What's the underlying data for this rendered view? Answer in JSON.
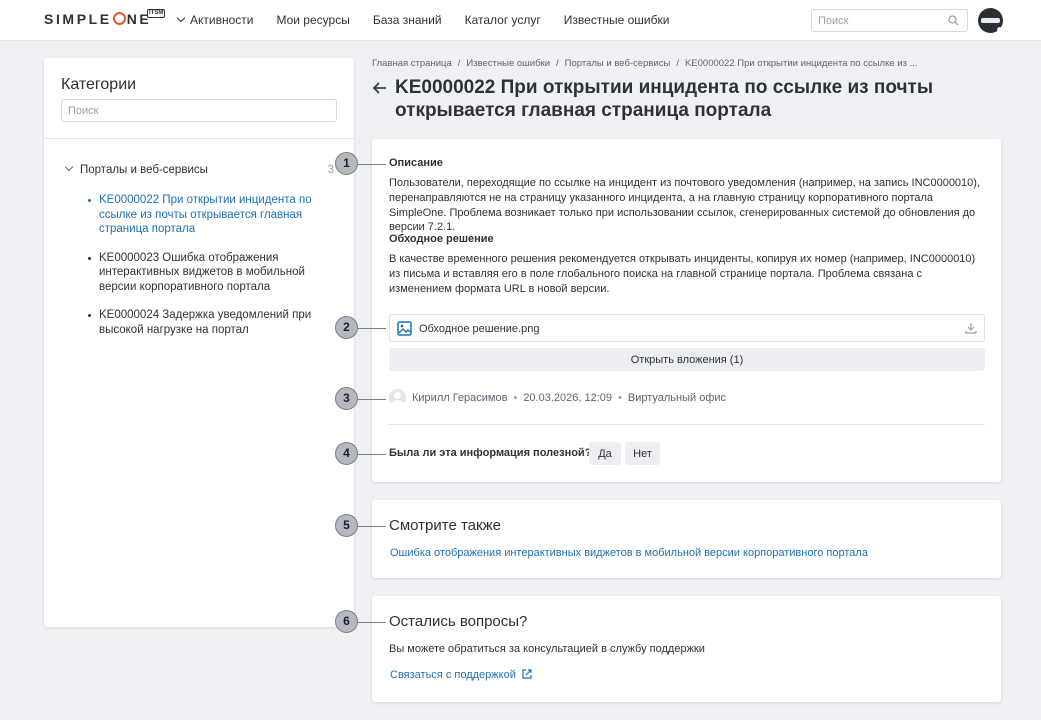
{
  "header": {
    "logo_text_1": "SIMPLE",
    "logo_text_2": "NE",
    "logo_badge": "ITSM",
    "nav": [
      "Активности",
      "Мои ресурсы",
      "База знаний",
      "Каталог услуг",
      "Известные ошибки"
    ],
    "search_placeholder": "Поиск"
  },
  "sidebar": {
    "title": "Категории",
    "search_placeholder": "Поиск",
    "category": {
      "label": "Порталы и веб-сервисы",
      "count": "3"
    },
    "items": [
      "KE0000022 При открытии инцидента по ссылке из почты открывается главная страница портала",
      "KE0000023 Ошибка отображения интерактивных виджетов в мобильной версии корпоративного портала",
      "KE0000024 Задержка уведомлений при высокой нагрузке на портал"
    ]
  },
  "breadcrumb": [
    "Главная страница",
    "Известные ошибки",
    "Порталы и веб-сервисы",
    "KE0000022 При открытии инцидента по ссылке из ..."
  ],
  "title": "KE0000022 При открытии инцидента по ссылке из почты открывается главная страница портала",
  "main": {
    "description_title": "Описание",
    "description_text": "Пользователи, переходящие по ссылке на инцидент из почтового уведомления (например, на запись INC0000010), перенаправляются не на страницу указанного инцидента, а на главную страницу корпоративного портала SimpleOne. Проблема возникает только при использовании ссылок, сгенерированных системой до обновления до версии 7.2.1.",
    "workaround_title": "Обходное решение",
    "workaround_text": "В качестве временного решения рекомендуется открывать инциденты, копируя их номер (например, INC0000010) из письма и вставляя его в поле глобального поиска на главной странице портала. Проблема связана с изменением формата URL в новой версии.",
    "attachment_name": "Обходное решение.png",
    "open_attachments": "Открыть вложения (1)",
    "author": "Кирилл Герасимов",
    "datetime": "20.03.2026, 12:09",
    "location": "Виртуальный офис",
    "useful_question": "Была ли эта информация полезной?",
    "yes": "Да",
    "no": "Нет"
  },
  "see_also": {
    "title": "Смотрите также",
    "link": "Ошибка отображения интерактивных виджетов в мобильной версии корпоративного портала"
  },
  "questions": {
    "title": "Остались вопросы?",
    "text": "Вы можете обратиться за консультацией в службу поддержки",
    "link": "Связаться с поддержкой"
  },
  "callouts": [
    "1",
    "2",
    "3",
    "4",
    "5",
    "6"
  ],
  "colors": {
    "accent": "#1f6fb2",
    "logo_ring": "#e4572e",
    "background": "#f0f1f4"
  }
}
